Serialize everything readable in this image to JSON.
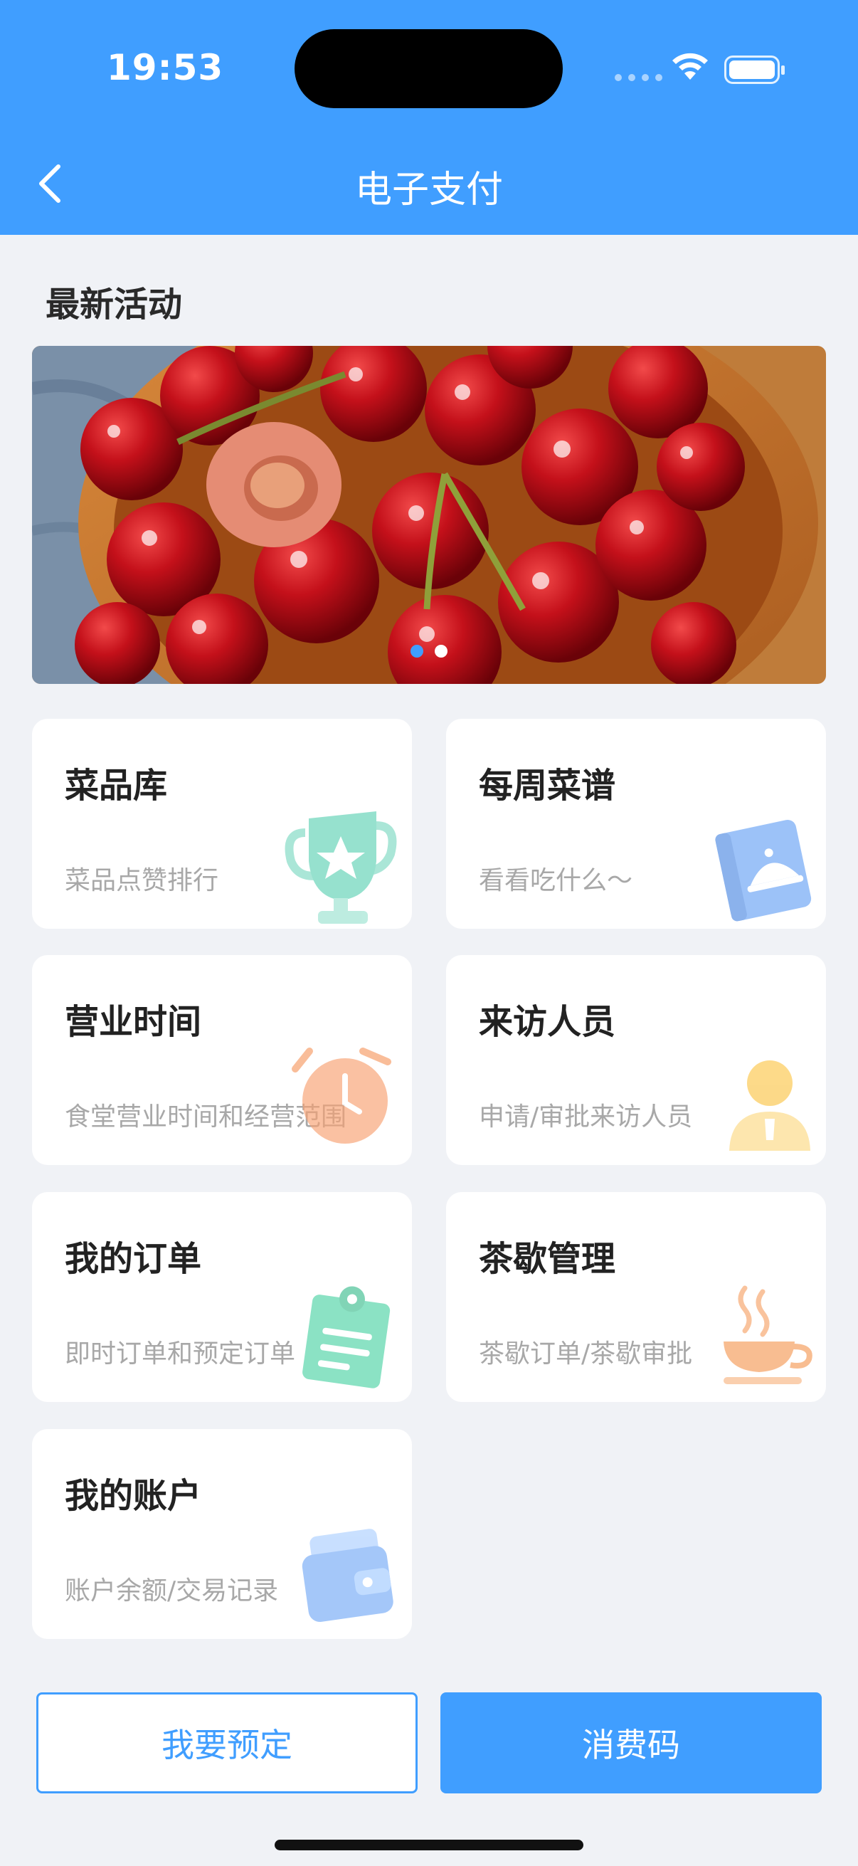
{
  "status_bar": {
    "time": "19:53"
  },
  "nav": {
    "title": "电子支付",
    "back_icon": "chevron-left-icon"
  },
  "section": {
    "title": "最新活动"
  },
  "banner": {
    "dots": 2,
    "active_dot": 0,
    "subject": "cherries"
  },
  "cards": [
    {
      "title": "菜品库",
      "subtitle": "菜品点赞排行",
      "icon": "trophy-icon"
    },
    {
      "title": "每周菜谱",
      "subtitle": "看看吃什么～",
      "icon": "menu-book-icon"
    },
    {
      "title": "营业时间",
      "subtitle": "食堂营业时间和经营范围",
      "icon": "alarm-clock-icon"
    },
    {
      "title": "来访人员",
      "subtitle": "申请/审批来访人员",
      "icon": "person-icon"
    },
    {
      "title": "我的订单",
      "subtitle": "即时订单和预定订单",
      "icon": "clipboard-icon"
    },
    {
      "title": "茶歇管理",
      "subtitle": "茶歇订单/茶歇审批",
      "icon": "tea-cup-icon"
    },
    {
      "title": "我的账户",
      "subtitle": "账户余额/交易记录",
      "icon": "wallet-icon"
    }
  ],
  "buttons": {
    "reserve": "我要预定",
    "consume_code": "消费码"
  },
  "colors": {
    "primary": "#409EFF",
    "background": "#F0F2F6"
  }
}
